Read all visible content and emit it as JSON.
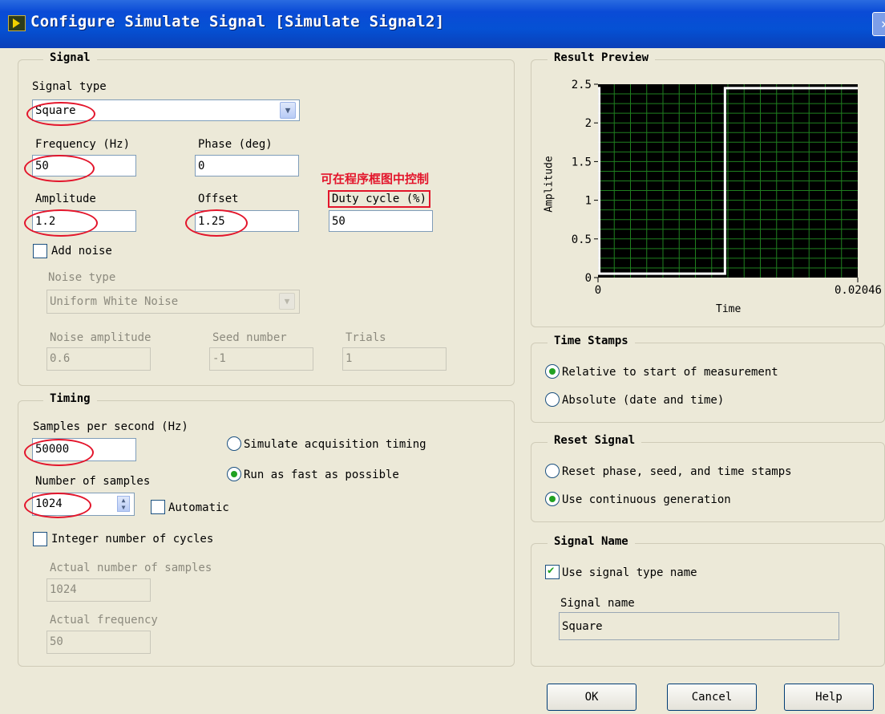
{
  "window": {
    "title": "Configure Simulate Signal [Simulate Signal2]"
  },
  "signal": {
    "group_title": "Signal",
    "signal_type_label": "Signal type",
    "signal_type_value": "Square",
    "frequency_label": "Frequency (Hz)",
    "frequency_value": "50",
    "phase_label": "Phase (deg)",
    "phase_value": "0",
    "annotation": "可在程序框图中控制",
    "amplitude_label": "Amplitude",
    "amplitude_value": "1.2",
    "offset_label": "Offset",
    "offset_value": "1.25",
    "duty_label": "Duty cycle (%)",
    "duty_value": "50",
    "add_noise_label": "Add noise",
    "add_noise_checked": false,
    "noise_type_label": "Noise type",
    "noise_type_value": "Uniform White Noise",
    "noise_amplitude_label": "Noise amplitude",
    "noise_amplitude_value": "0.6",
    "seed_label": "Seed number",
    "seed_value": "-1",
    "trials_label": "Trials",
    "trials_value": "1"
  },
  "timing": {
    "group_title": "Timing",
    "sps_label": "Samples per second (Hz)",
    "sps_value": "50000",
    "simulate_label": "Simulate acquisition timing",
    "run_fast_label": "Run as fast as possible",
    "nsamples_label": "Number of samples",
    "nsamples_value": "1024",
    "automatic_label": "Automatic",
    "integer_cycles_label": "Integer number of cycles",
    "actual_samples_label": "Actual number of samples",
    "actual_samples_value": "1024",
    "actual_freq_label": "Actual frequency",
    "actual_freq_value": "50"
  },
  "preview": {
    "group_title": "Result Preview",
    "ylabel": "Amplitude",
    "xlabel": "Time",
    "y_ticks": [
      "2.5",
      "2",
      "1.5",
      "1",
      "0.5",
      "0"
    ],
    "x_ticks": [
      "0",
      "0.02046"
    ]
  },
  "chart_data": {
    "type": "line",
    "title": "",
    "xlabel": "Time",
    "ylabel": "Amplitude",
    "xlim": [
      0,
      0.02046
    ],
    "ylim": [
      0,
      2.5
    ],
    "series": [
      {
        "x": [
          0,
          0.0001,
          0.0001,
          0.01,
          0.01,
          0.02046
        ],
        "y": [
          2.45,
          2.45,
          0.05,
          0.05,
          2.45,
          2.45
        ]
      }
    ],
    "grid": true,
    "colors": {
      "background": "#000000",
      "grid": "#1f7f1f",
      "line": "#ffffff"
    }
  },
  "timestamps": {
    "group_title": "Time Stamps",
    "relative_label": "Relative to start of measurement",
    "absolute_label": "Absolute (date and time)"
  },
  "reset": {
    "group_title": "Reset Signal",
    "reset_label": "Reset phase, seed, and time stamps",
    "continuous_label": "Use continuous generation"
  },
  "signal_name": {
    "group_title": "Signal Name",
    "use_type_label": "Use signal type name",
    "name_label": "Signal name",
    "name_value": "Square"
  },
  "buttons": {
    "ok": "OK",
    "cancel": "Cancel",
    "help": "Help"
  },
  "colors": {
    "annotation_red": "#e3152b",
    "title_blue": "#0a4bd6",
    "radio_green": "#21a121"
  }
}
